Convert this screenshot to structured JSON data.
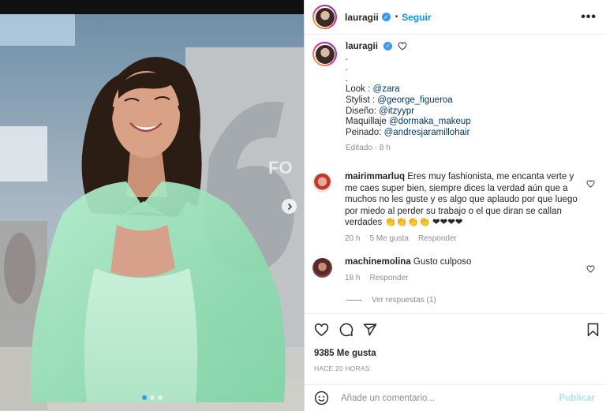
{
  "post": {
    "username": "lauragii",
    "follow_label": "Seguir",
    "separator": "•",
    "more_label": "•••",
    "verified_mark": "✓"
  },
  "caption": {
    "username": "lauragii",
    "dots": [
      ".",
      ".",
      "."
    ],
    "credits": [
      {
        "label": "Look : ",
        "mention": "@zara"
      },
      {
        "label": "Stylist : ",
        "mention": "@george_figueroa"
      },
      {
        "label": "Diseño: ",
        "mention": "@itzyypr"
      },
      {
        "label": "Maquillaje ",
        "mention": "@dormaka_makeup"
      },
      {
        "label": "Peinado: ",
        "mention": "@andresjaramillohair"
      }
    ],
    "meta": "Editado · 8 h"
  },
  "comments": [
    {
      "username": "mairimmarluq",
      "text": "Eres muy fashionista, me encanta verte y me caes super bien, siempre dices la verdad aún que a muchos no les guste y es algo que aplaudo por que luego por miedo al perder su trabajo o el que diran se callan verdades 👏👏👏👏 ❤❤❤❤",
      "time": "20 h",
      "likes": "5 Me gusta",
      "reply": "Responder"
    },
    {
      "username": "machinemolina",
      "text": "Gusto culposo",
      "time": "18 h",
      "reply": "Responder"
    }
  ],
  "view_replies": "Ver respuestas (1)",
  "likes_count": "9385 Me gusta",
  "timestamp": "HACE 20 HORAS",
  "add_comment": {
    "placeholder": "Añade un comentario...",
    "publish_label": "Publicar"
  },
  "colors": {
    "link_blue": "#0095f6",
    "mention": "#00376b",
    "dress": "#a8e6c0"
  },
  "icons": [
    "chevron-right-icon",
    "heart-icon",
    "comment-icon",
    "share-icon",
    "bookmark-icon",
    "emoji-icon",
    "more-icon",
    "verified-icon"
  ]
}
